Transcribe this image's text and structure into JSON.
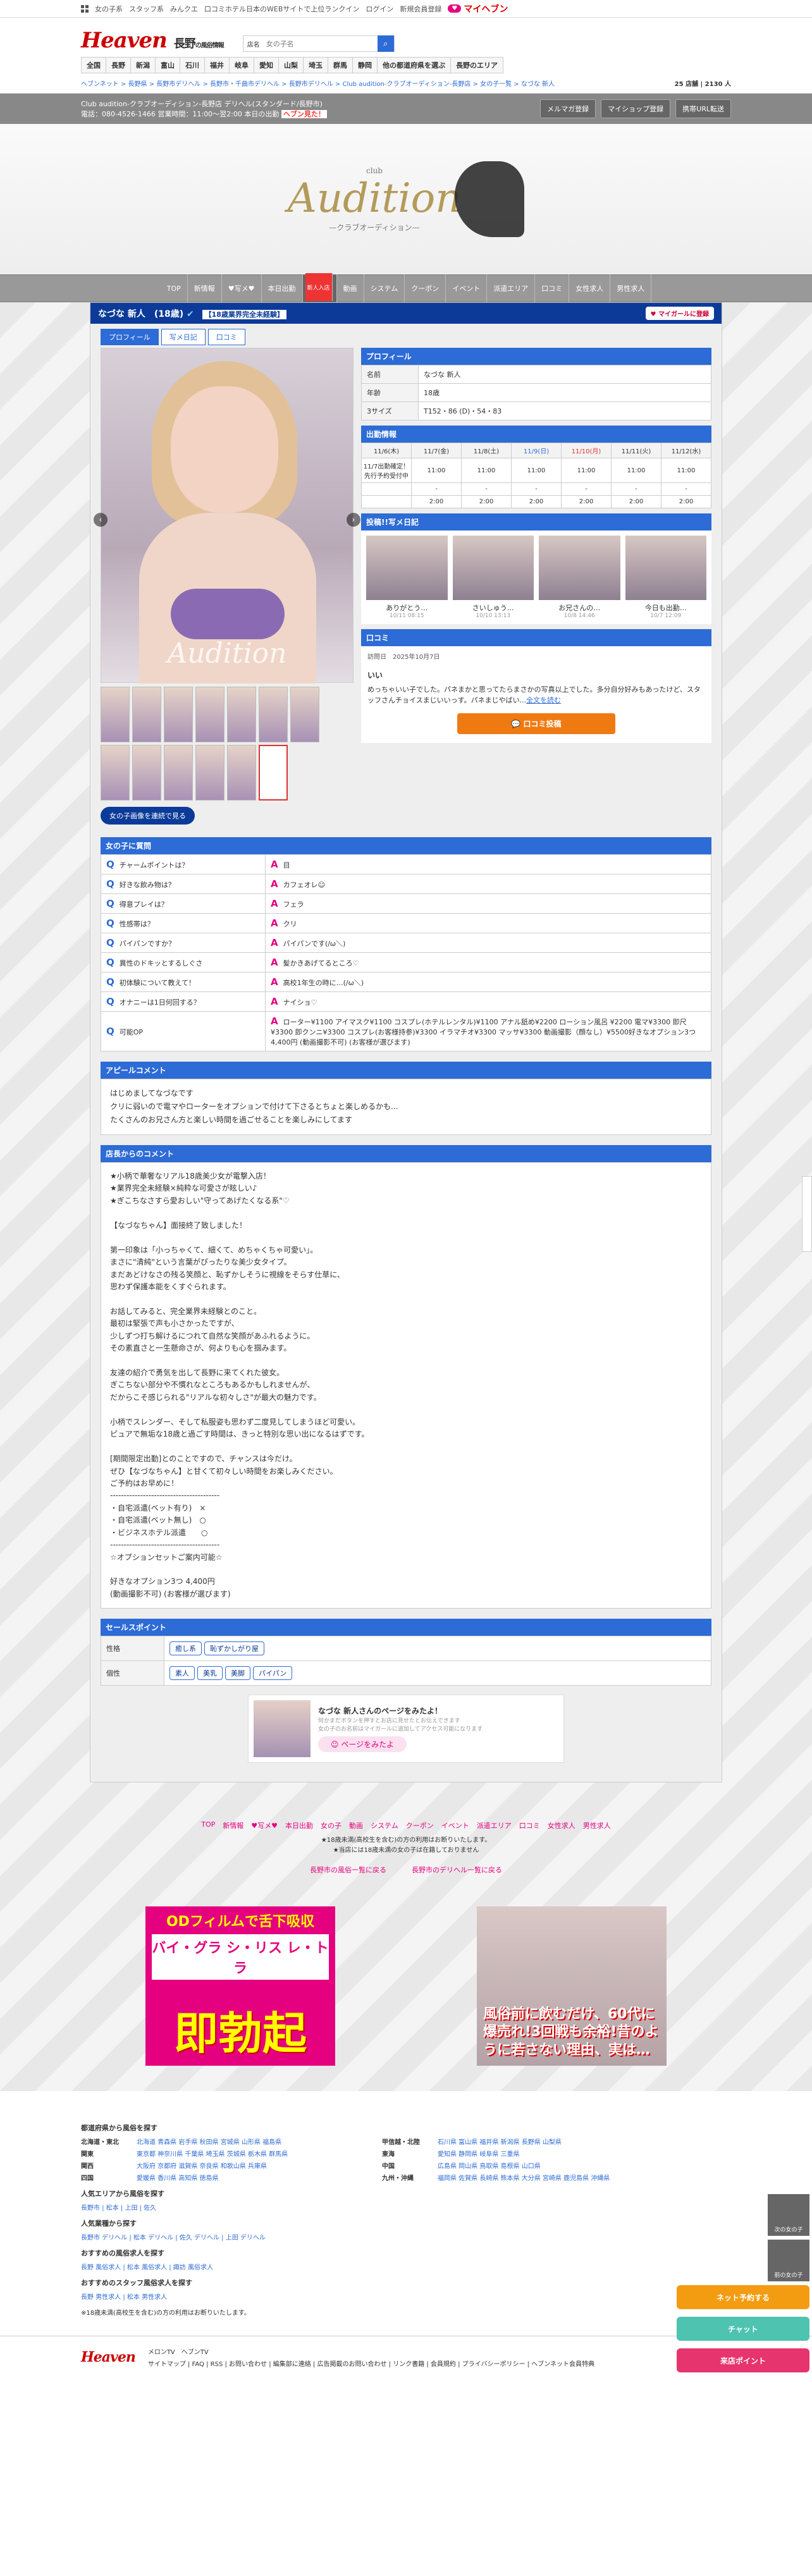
{
  "topbar": {
    "links": [
      "女の子系",
      "スタッフ系",
      "みんクエ",
      "口コミホテル"
    ],
    "right": [
      "日本のWEBサイトで上位ランクイン",
      "ログイン",
      "新規会員登録"
    ],
    "heaven": "マイヘブン"
  },
  "header": {
    "logo": "Heaven",
    "area": "長野",
    "sub": "の風俗情報",
    "search_label": "店名",
    "search_ph": "女の子名"
  },
  "areas": [
    "全国",
    "長野",
    "新潟",
    "富山",
    "石川",
    "福井",
    "岐阜",
    "愛知",
    "山梨",
    "埼玉",
    "群馬",
    "静岡",
    "他の都道府県を選ぶ",
    "長野のエリア"
  ],
  "crumb": "ヘブンネット > 長野県 > 長野市デリヘル > 長野市・千曲市デリヘル > 長野市デリヘル > Club audition-クラブオーディション-長野店 > 女の子一覧 > なづな 新人",
  "counts": "25 店舗 | 2130 人",
  "shop": {
    "name": "Club audition-クラブオーディション-長野店 デリヘル(スタンダード/長野市)",
    "tel": "電話：080-4526-1466 営業時間：11:00～翌2:00 本日の出勤",
    "hot": "ヘブン見た！",
    "btns": [
      "メルマガ登録",
      "マイショップ登録",
      "携帯URL転送"
    ]
  },
  "banner": {
    "brand": "Audition",
    "pre": "club",
    "sub": "—クラブオーディション—"
  },
  "shopnav": [
    {
      "t": "TOP"
    },
    {
      "t": "新情報"
    },
    {
      "t": "♥写メ♥"
    },
    {
      "t": "本日出勤"
    },
    {
      "t": "女の子",
      "act": true,
      "new": "新人入店"
    },
    {
      "t": "動画"
    },
    {
      "t": "システム"
    },
    {
      "t": "クーポン"
    },
    {
      "t": "イベント"
    },
    {
      "t": "派遣エリア"
    },
    {
      "t": "口コミ"
    },
    {
      "t": "女性求人"
    },
    {
      "t": "男性求人"
    }
  ],
  "girl": {
    "name": "なづな 新人　(18歳)",
    "tag": "【18歳業界完全未経験】",
    "fav": "マイガールに登録",
    "tabs": [
      "プロフィール",
      "写メ日記",
      "口コミ"
    ],
    "photo_wm": "Audition",
    "slide": "女の子画像を連続で見る"
  },
  "profile": {
    "title": "プロフィール",
    "rows": [
      [
        "名前",
        "なづな 新人"
      ],
      [
        "年齢",
        "18歳"
      ],
      [
        "3サイズ",
        "T152・86 (D)・54・83"
      ]
    ]
  },
  "schedule": {
    "title": "出勤情報",
    "days": [
      "11/6(木)",
      "11/7(金)",
      "11/8(土)",
      "11/9(日)",
      "11/10(月)",
      "11/11(火)",
      "11/12(水)"
    ],
    "r1": [
      "11/7出勤確定！先行予約受付中",
      "11:00",
      "11:00",
      "11:00",
      "11:00",
      "11:00",
      "11:00"
    ],
    "r2": [
      "",
      "-",
      "-",
      "-",
      "-",
      "-",
      "-"
    ],
    "r3": [
      "",
      "2:00",
      "2:00",
      "2:00",
      "2:00",
      "2:00",
      "2:00"
    ]
  },
  "diary": {
    "title": "投稿!!写メ日記",
    "items": [
      {
        "t": "ありがとう…",
        "d": "10/11 08:15"
      },
      {
        "t": "さいしゅう…",
        "d": "10/10 13:13"
      },
      {
        "t": "お兄さんの…",
        "d": "10/8 14:46"
      },
      {
        "t": "今日も出勤…",
        "d": "10/7 12:09"
      }
    ]
  },
  "review": {
    "title": "口コミ",
    "meta": "訪問日　2025年10月7日",
    "head": "いい",
    "body": "めっちゃいい子でした。パネまかと思ってたらまさかの写真以上でした。多分自分好みもあったけど、スタッフさんチョイスまじいいっす。パネまじやばい...",
    "more": "全文を読む",
    "btn": "口コミ投稿"
  },
  "qa": {
    "title": "女の子に質問",
    "rows": [
      [
        "チャームポイントは？",
        "目"
      ],
      [
        "好きな飲み物は？",
        "カフェオレ☺"
      ],
      [
        "得意プレイは？",
        "フェラ"
      ],
      [
        "性感帯は？",
        "クリ"
      ],
      [
        "パイパンですか？",
        "パイパンです(/ω＼)"
      ],
      [
        "異性のドキッとするしぐさ",
        "髪かきあげてるところ♡"
      ],
      [
        "初体験について教えて！",
        "高校1年生の時に…(/ω＼)"
      ],
      [
        "オナニーは1日何回する？",
        "ナイショ♡"
      ],
      [
        "可能OP",
        "ローター¥1100 アイマスク¥1100 コスプレ(ホテルレンタル)¥1100 アナル舐め¥2200 ローション風呂 ¥2200 電マ¥3300 即尺¥3300 即クンニ¥3300 コスプレ(お客様持参)¥3300 イラマチオ¥3300 マッサ¥3300 動画撮影（顔なし）¥5500好きなオプション3つ 4,400円 (動画撮影不可) (お客様が選びます)"
      ]
    ]
  },
  "appeal": {
    "title": "アピールコメント",
    "text": "はじめましてなづなです\nクリに弱いので電マやローターをオプションで付けて下さるとちょと楽しめるかも...\nたくさんのお兄さん方と楽しい時間を過ごせることを楽しみにしてます"
  },
  "shopcomment": {
    "title": "店長からのコメント",
    "text": "★小柄で華奢なリアル18歳美少女が電撃入店！\n★業界完全未経験×純粋な可愛さが眩しい♪\n★ぎこちなさすら愛おしい\"守ってあげたくなる系\"♡\n\n【なづなちゃん】面接終了致しました！\n\n第一印象は「小っちゃくて、細くて、めちゃくちゃ可愛い」。\nまさに\"清純\"という言葉がぴったりな美少女タイプ。\nまだあどけなさの残る笑顔と、恥ずかしそうに視線をそらす仕草に、\n思わず保護本能をくすぐられます。\n\nお話してみると、完全業界未経験とのこと。\n最初は緊張で声も小さかったですが、\n少しずつ打ち解けるにつれて自然な笑顔があふれるように。\nその素直さと一生懸命さが、何よりも心を掴みます。\n\n友達の紹介で勇気を出して長野に来てくれた彼女。\nぎこちない部分や不慣れなところもあるかもしれませんが、\nだからこそ感じられる\"リアルな初々しさ\"が最大の魅力です。\n\n小柄でスレンダー、そして私服姿も思わず二度見してしまうほど可愛い。\nピュアで無垢な18歳と過ごす時間は、きっと特別な思い出になるはずです。\n\n[期間限定出勤]とのことですので、チャンスは今だけ。\nぜひ【なづなちゃん】と甘くて初々しい時間をお楽しみください。\nご予約はお早めに！\n----------------------------------------\n・自宅派遣(ベット有り)　×\n・自宅派遣(ベット無し)　○\n・ビジネスホテル派遣　　○\n----------------------------------------\n☆オプションセットご案内可能☆\n\n好きなオプション3つ 4,400円\n(動画撮影不可) (お客様が選びます)"
  },
  "sales": {
    "title": "セールスポイント",
    "rows": [
      {
        "k": "性格",
        "v": [
          "癒し系",
          "恥ずかしがり屋"
        ]
      },
      {
        "k": "個性",
        "v": [
          "素人",
          "美乳",
          "美脚",
          "パイパン"
        ]
      }
    ]
  },
  "invite": {
    "text": "なづな 新人さんのページをみたよ！",
    "sub1": "何かまだボタンを押すとお店に見せたとお伝えできます",
    "sub2": "女の子のお名前はマイガールに追加してアクセス可能になります",
    "btn": "ページをみたよ"
  },
  "footnav": [
    "TOP",
    "新情報",
    "♥写メ♥",
    "本日出勤",
    "女の子",
    "動画",
    "システム",
    "クーポン",
    "イベント",
    "派遣エリア",
    "口コミ",
    "女性求人",
    "男性求人"
  ],
  "footnote": [
    "★18歳未満(高校生を含む)の方の利用はお断りいたします。",
    "★当店には18歳未満の女の子は在籍しておりません"
  ],
  "footlinks": [
    "長野市の風俗一覧に戻る",
    "長野市のデリヘル一覧に戻る"
  ],
  "ad1": {
    "t1": "ODフィルムで舌下吸収",
    "t2": "バイ・グラ シ・リス レ・トラ",
    "t3": "即勃起"
  },
  "ad2": {
    "t": "風俗前に飲むだけ、60代に爆売れ!3回戦も余裕!昔のように若さない理由、実は…"
  },
  "regions": {
    "title": "都道府県から風俗を探す",
    "rows": [
      [
        "北海道・東北",
        "北海道 青森県 岩手県 秋田県 宮城県 山形県 福島県",
        "甲信越・北陸",
        "石川県 富山県 福井県 新潟県 長野県 山梨県"
      ],
      [
        "関東",
        "東京都 神奈川県 千葉県 埼玉県 茨城県 栃木県 群馬県",
        "東海",
        "愛知県 静岡県 岐阜県 三重県"
      ],
      [
        "関西",
        "大阪府 京都府 滋賀県 奈良県 和歌山県 兵庫県",
        "中国",
        "広島県 岡山県 鳥取県 島根県 山口県"
      ],
      [
        "四国",
        "愛媛県 香川県 高知県 徳島県",
        "九州・沖縄",
        "福岡県 佐賀県 長崎県 熊本県 大分県 宮崎県 鹿児島県 沖縄県"
      ]
    ],
    "pop_area": "人気エリアから風俗を探す",
    "pop_area_l": "長野市 | 松本 | 上田 | 佐久",
    "pop_gen": "人気業種から探す",
    "pop_gen_l": "長野市 デリヘル | 松本 デリヘル | 佐久 デリヘル | 上田 デリヘル",
    "rec1": "おすすめの風俗求人を探す",
    "rec1_l": "長野 風俗求人 | 松本 風俗求人 | 諏訪 風俗求人",
    "rec2": "おすすめのスタッフ風俗求人を探す",
    "rec2_l": "長野 男性求人 | 松本 男性求人",
    "warn": "※18歳未満(高校生を含む)の方の利用はお断りいたします。"
  },
  "footer": {
    "links": "サイトマップ | FAQ | RSS | お問い合わせ | 編集部に連絡 | 広告掲載のお問い合わせ | リンク書籍 | 会員規約 | プライバシーポリシー | ヘブンネット会員特典",
    "apps": [
      "メロンTV",
      "ヘブンTV"
    ]
  },
  "sidebtns": {
    "next": "次の女の子",
    "prev": "前の女の子",
    "net": "ネット予約する",
    "chat": "チャット",
    "point": "来店ポイント"
  },
  "colors": {
    "navy": "#0b3a98",
    "blue": "#2d6bd6",
    "pink": "#e4007f",
    "orange": "#f07a12"
  }
}
